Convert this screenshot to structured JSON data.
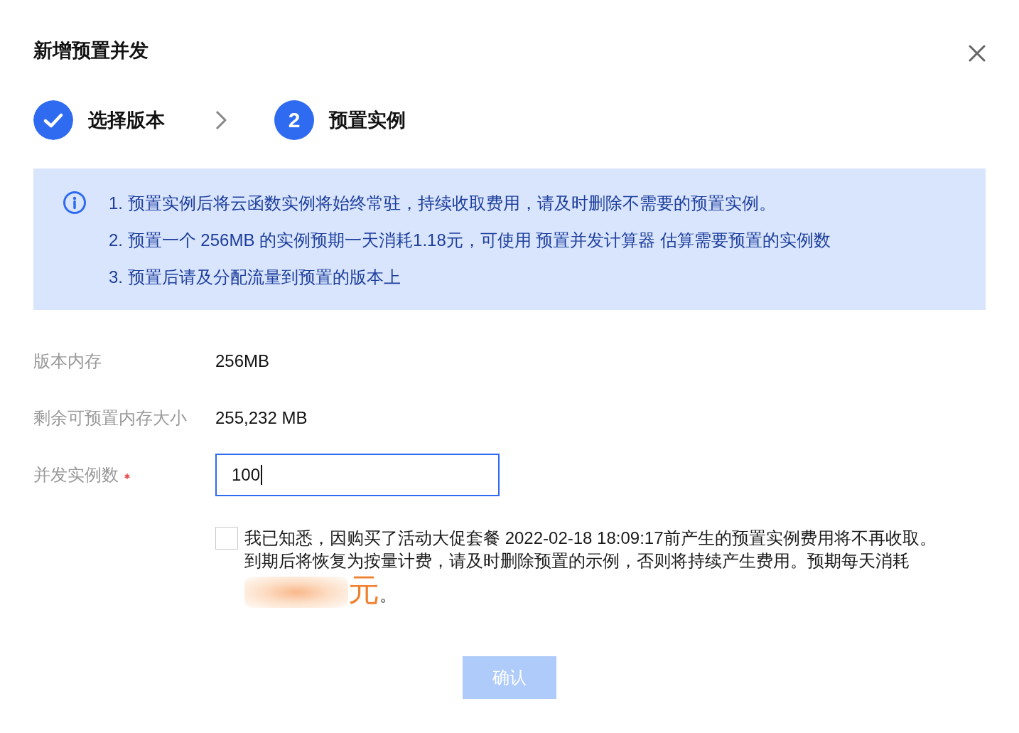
{
  "dialog": {
    "title": "新增预置并发"
  },
  "steps": [
    {
      "label": "选择版本",
      "completed": true
    },
    {
      "label": "预置实例",
      "completed": false,
      "number": "2"
    }
  ],
  "notice": {
    "lines": [
      "1. 预置实例后将云函数实例将始终常驻，持续收取费用，请及时删除不需要的预置实例。",
      "2. 预置一个 256MB 的实例预期一天消耗1.18元，可使用 预置并发计算器 估算需要预置的实例数",
      "3. 预置后请及分配流量到预置的版本上"
    ]
  },
  "form": {
    "fields": [
      {
        "label": "版本内存",
        "kind": "text",
        "value": "256MB",
        "required": false
      },
      {
        "label": "剩余可预置内存大小",
        "kind": "text",
        "value": "255,232 MB",
        "required": false
      },
      {
        "label": "并发实例数",
        "kind": "input",
        "value": "100",
        "required": true,
        "focused": true
      }
    ]
  },
  "agreement": {
    "checked": false,
    "text": "我已知悉，因购买了活动大促套餐 2022-02-18 18:09:17前产生的预置实例费用将不再收取。到期后将恢复为按量计费，请及时删除预置的示例，否则将持续产生费用。预期每天消耗",
    "unit": "元",
    "ending": "。"
  },
  "confirm_button": {
    "label": "确认",
    "disabled": true
  }
}
